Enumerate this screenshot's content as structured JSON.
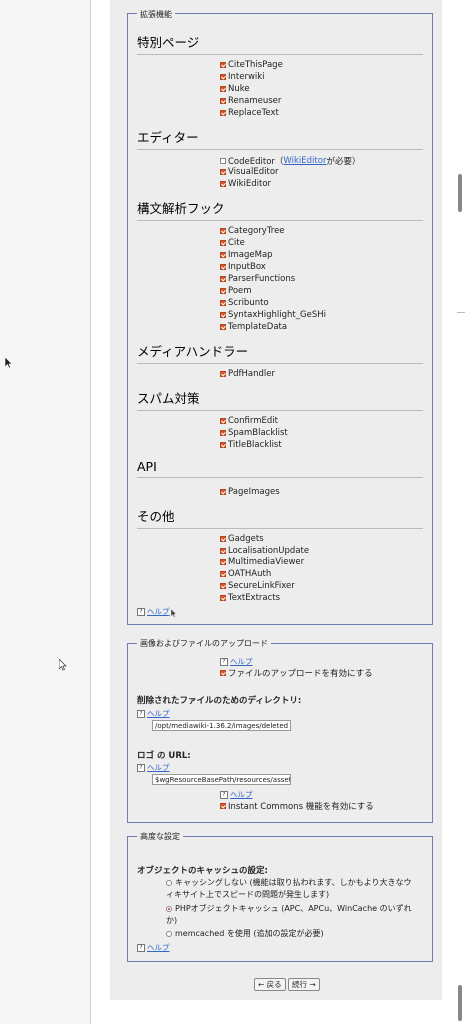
{
  "extensions": {
    "legend": "拡張機能",
    "groups": {
      "special": {
        "title": "特別ページ",
        "items": [
          "CiteThisPage",
          "Interwiki",
          "Nuke",
          "Renameuser",
          "ReplaceText"
        ]
      },
      "editor": {
        "title": "エディター",
        "codeeditor": "CodeEditor（",
        "codeeditor_link": "WikiEditor",
        "codeeditor_suffix": "が必要）",
        "items": [
          "VisualEditor",
          "WikiEditor"
        ]
      },
      "parser": {
        "title": "構文解析フック",
        "items": [
          "CategoryTree",
          "Cite",
          "ImageMap",
          "InputBox",
          "ParserFunctions",
          "Poem",
          "Scribunto",
          "SyntaxHighlight_GeSHi",
          "TemplateData"
        ]
      },
      "media": {
        "title": "メディアハンドラー",
        "items": [
          "PdfHandler"
        ]
      },
      "spam": {
        "title": "スパム対策",
        "items": [
          "ConfirmEdit",
          "SpamBlacklist",
          "TitleBlacklist"
        ]
      },
      "api": {
        "title": "API",
        "items": [
          "PageImages"
        ]
      },
      "other": {
        "title": "その他",
        "items": [
          "Gadgets",
          "LocalisationUpdate",
          "MultimediaViewer",
          "OATHAuth",
          "SecureLinkFixer",
          "TextExtracts"
        ]
      }
    },
    "help": "ヘルプ"
  },
  "upload": {
    "legend": "画像およびファイルのアップロード",
    "help": "ヘルプ",
    "enable_upload": "ファイルのアップロードを有効にする",
    "deleted_dir_label": "削除されたファイルのためのディレクトリ:",
    "deleted_dir_value": "/opt/mediawiki-1.36.2/images/deleted",
    "logo_label": "ロゴ の URL:",
    "logo_value": "$wgResourceBasePath/resources/assets/wiki.png",
    "instant_commons": "Instant Commons 機能を有効にする"
  },
  "advanced": {
    "legend": "高度な設定",
    "cache_label": "オブジェクトのキャッシュの設定:",
    "options": [
      "キャッシングしない (機能は取り払われます、しかもより大きなウィキサイト上でスピードの問題が発生します)",
      "PHPオブジェクトキャッシュ (APC、APCu、WinCache のいずれか)",
      "memcached を使用 (追加の設定が必要)"
    ],
    "help": "ヘルプ"
  },
  "nav": {
    "back": "← 戻る",
    "next": "続行 →"
  },
  "colors": {
    "accent_link": "#3366cc",
    "fieldset_border": "#6f7cb3",
    "checkbox": "#d8552a"
  }
}
